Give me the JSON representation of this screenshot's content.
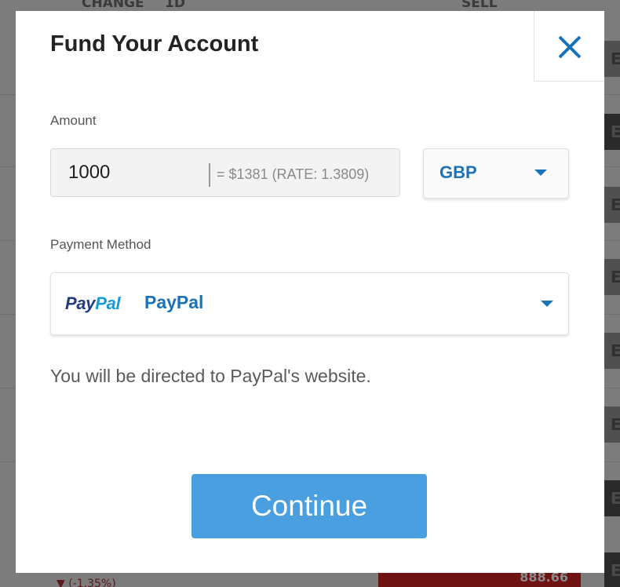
{
  "background": {
    "headers": [
      "CHANGE",
      "1D",
      "SELL"
    ],
    "bottom_change": "▼ (-1.35%)",
    "bottom_value": "888.66"
  },
  "modal": {
    "title": "Fund Your Account",
    "close_icon": "close-icon",
    "amount": {
      "label": "Amount",
      "value": "1000",
      "conversion": "= $1381   (RATE: 1.3809)"
    },
    "currency": {
      "selected": "GBP"
    },
    "payment_method": {
      "label": "Payment Method",
      "logo_pay": "Pay",
      "logo_pal": "Pal",
      "selected": "PayPal"
    },
    "redirect_note": "You will be directed to PayPal's website.",
    "continue_label": "Continue"
  },
  "colors": {
    "accent": "#1a72b8",
    "button": "#4a9fe0",
    "paypal_dark": "#253b80",
    "paypal_light": "#179bd7"
  }
}
